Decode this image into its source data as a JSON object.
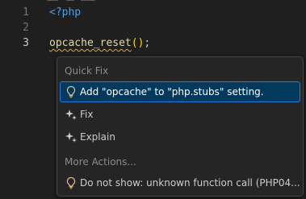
{
  "editor": {
    "lines": [
      {
        "number": "1",
        "tag": "<?php"
      },
      {
        "number": "2",
        "tag": ""
      },
      {
        "number": "3",
        "function": "opcache_reset",
        "open_paren": "(",
        "close_paren": ")",
        "semicolon": ";"
      }
    ],
    "active_line": "3"
  },
  "quick_fix_menu": {
    "section_quick_fix": "Quick Fix",
    "items": [
      {
        "label": "Add \"opcache\" to \"php.stubs\" setting.",
        "icon": "lightbulb-icon",
        "selected": true
      },
      {
        "label": "Fix",
        "icon": "sparkle-icon",
        "selected": false
      },
      {
        "label": "Explain",
        "icon": "sparkle-icon",
        "selected": false
      }
    ],
    "section_more_actions": "More Actions...",
    "more_items": [
      {
        "label": "Do not show: unknown function call (PHP04...",
        "icon": "lightbulb-icon",
        "selected": false
      }
    ]
  },
  "colors": {
    "background": "#1f1f1f",
    "menu_background": "#252526",
    "selection": "#04395e",
    "selection_border": "#2b79d8",
    "lightbulb": "#e2c08d",
    "php_tag": "#569cd6",
    "function_name": "#dcdcaa",
    "squiggle": "#e2a83c"
  }
}
